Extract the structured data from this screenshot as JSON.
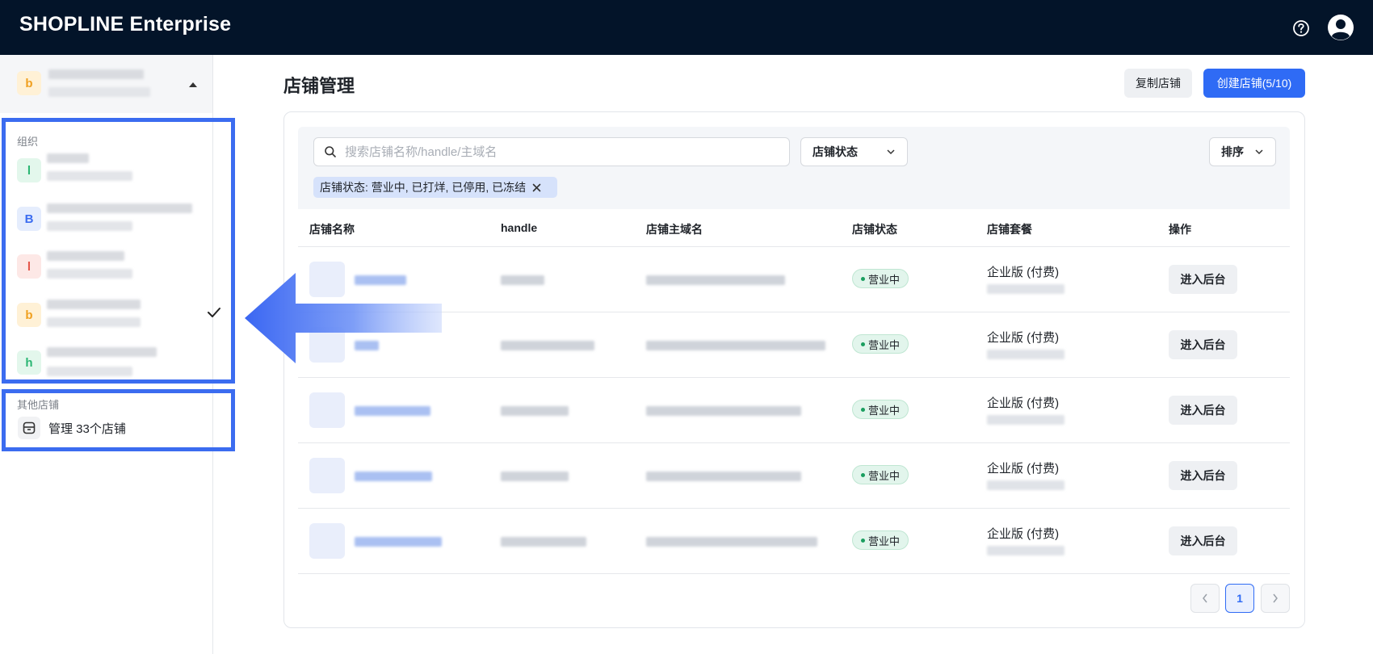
{
  "app": {
    "brand": "SHOPLINE Enterprise"
  },
  "header": {
    "help_icon": "help-circle-icon",
    "user_icon": "user-avatar-icon"
  },
  "sidebar": {
    "current_org_initial": "b",
    "section_org_label": "组织",
    "orgs": [
      {
        "initial": "l",
        "bg": "#e3f7ec",
        "fg": "#2bb673",
        "selected": false
      },
      {
        "initial": "B",
        "bg": "#e5edfd",
        "fg": "#3b6cf0",
        "selected": false
      },
      {
        "initial": "l",
        "bg": "#fde8e6",
        "fg": "#e5574b",
        "selected": false
      },
      {
        "initial": "b",
        "bg": "#fff1d6",
        "fg": "#f0a020",
        "selected": true
      },
      {
        "initial": "h",
        "bg": "#e3f7ec",
        "fg": "#2bb673",
        "selected": false
      }
    ],
    "section_other_label": "其他店铺",
    "manage_label": "管理 33个店铺"
  },
  "main": {
    "title": "店铺管理",
    "copy_button": "复制店铺",
    "create_button": "创建店铺(5/10)",
    "search_placeholder": "搜索店铺名称/handle/主域名",
    "status_select": "店铺状态",
    "sort_select": "排序",
    "filter_tag": "店铺状态: 营业中, 已打烊, 已停用, 已冻结",
    "columns": [
      "店铺名称",
      "handle",
      "店铺主域名",
      "店铺状态",
      "店铺套餐",
      "操作"
    ],
    "rows": [
      {
        "status": "营业中",
        "plan": "企业版 (付费)",
        "action": "进入后台"
      },
      {
        "status": "营业中",
        "plan": "企业版 (付费)",
        "action": "进入后台"
      },
      {
        "status": "营业中",
        "plan": "企业版 (付费)",
        "action": "进入后台"
      },
      {
        "status": "营业中",
        "plan": "企业版 (付费)",
        "action": "进入后台"
      },
      {
        "status": "营业中",
        "plan": "企业版 (付费)",
        "action": "进入后台"
      }
    ],
    "pagination": {
      "current_page": "1"
    }
  },
  "colors": {
    "primary": "#2f6bf5",
    "topbar": "#031429",
    "highlight": "#3b6cf0"
  }
}
